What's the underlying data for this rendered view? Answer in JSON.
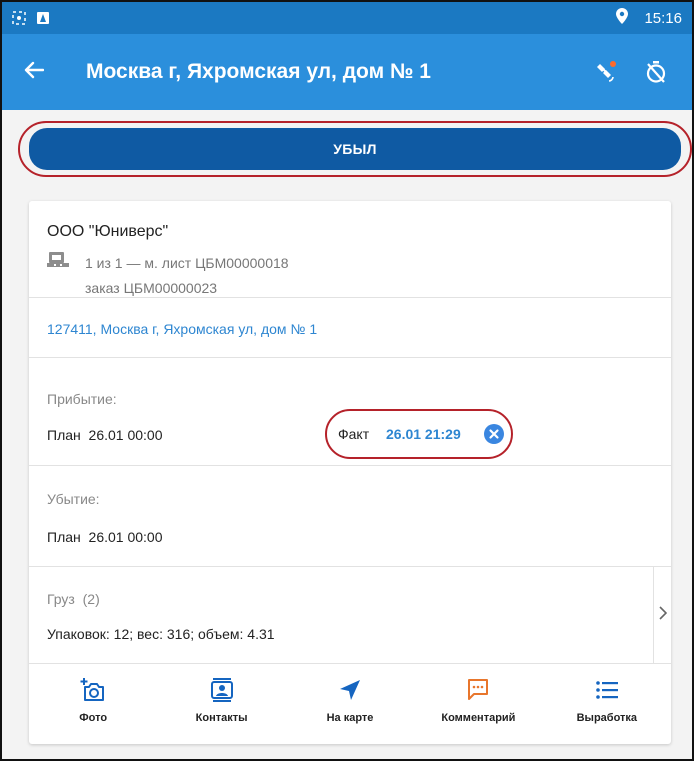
{
  "status_bar": {
    "time": "15:16",
    "icons": [
      "screenshot-icon",
      "notification-icon",
      "location-icon"
    ]
  },
  "app_bar": {
    "title": "Москва г, Яхромская ул, дом № 1",
    "icons": [
      "back-arrow-icon",
      "satellite-signal-icon",
      "timer-off-icon"
    ]
  },
  "depart_button": {
    "label": "УБЫЛ"
  },
  "card": {
    "company": "ООО \"Юниверс\"",
    "route_line": "1 из 1 — м. лист ЦБМ00000018",
    "order_line": "заказ ЦБМ00000023",
    "address": "127411, Москва г, Яхромская ул, дом № 1",
    "arrival": {
      "title": "Прибытие:",
      "plan_label": "План",
      "plan_time": "26.01 00:00",
      "fact_label": "Факт",
      "fact_time": "26.01 21:29"
    },
    "departure": {
      "title": "Убытие:",
      "plan_label": "План",
      "plan_time": "26.01 00:00"
    },
    "cargo": {
      "title": "Груз",
      "count": "(2)",
      "summary": "Упаковок: 12; вес: 316; объем: 4.31"
    }
  },
  "toolbar": [
    {
      "label": "Фото",
      "icon": "add-photo-icon"
    },
    {
      "label": "Контакты",
      "icon": "contacts-icon"
    },
    {
      "label": "На карте",
      "icon": "navigation-arrow-icon"
    },
    {
      "label": "Комментарий",
      "icon": "comment-icon"
    },
    {
      "label": "Выработка",
      "icon": "list-icon"
    }
  ],
  "colors": {
    "status_bar": "#1b79c2",
    "app_bar": "#2b8fdc",
    "depart_button": "#0f5aa3",
    "link": "#2e86d1",
    "highlight": "#b5222a",
    "comment_icon": "#e8762c"
  }
}
